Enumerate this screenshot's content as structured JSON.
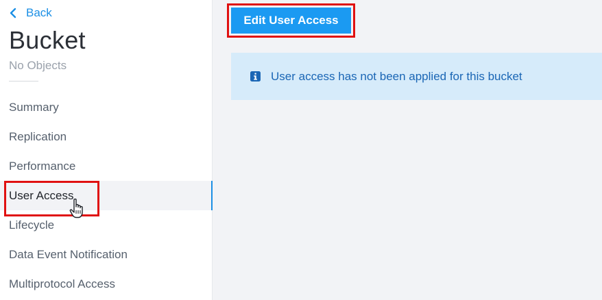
{
  "sidebar": {
    "back_label": "Back",
    "title": "Bucket",
    "subtitle": "No Objects",
    "items": [
      {
        "label": "Summary"
      },
      {
        "label": "Replication"
      },
      {
        "label": "Performance"
      },
      {
        "label": "User Access",
        "active": true
      },
      {
        "label": "Lifecycle"
      },
      {
        "label": "Data Event Notification"
      },
      {
        "label": "Multiprotocol Access"
      }
    ]
  },
  "main": {
    "edit_button_label": "Edit User Access",
    "info_message": "User access has not been applied for this bucket"
  },
  "colors": {
    "accent": "#1b9af2",
    "link": "#1b8fe5",
    "info_bg": "#d6ebfa",
    "info_text": "#1a66b5",
    "highlight": "#e01010"
  },
  "icons": {
    "back": "chevron-left-icon",
    "info": "info-icon",
    "cursor": "hand-pointer-icon"
  }
}
